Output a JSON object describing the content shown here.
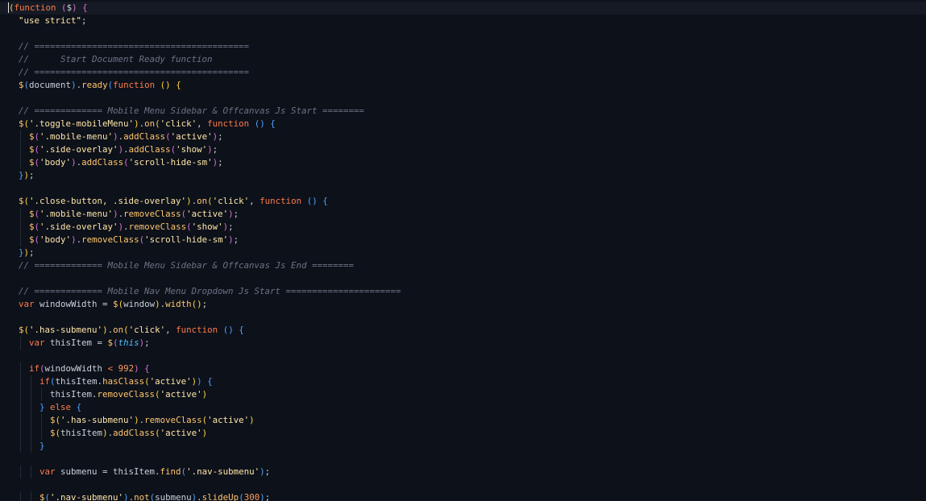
{
  "colors": {
    "background": "#0d111a",
    "current_line": "#151a24",
    "indent_guide": "#232a36",
    "keyword": "#ff7b4a",
    "function": "#ffc66d",
    "string": "#ffe6a8",
    "comment": "#6b7385",
    "bracket_1": "#ffd43b",
    "bracket_2": "#da70d6",
    "bracket_3": "#4fa3ff",
    "number": "#ff9d5c",
    "this": "#4fc1ff",
    "text": "#c9d1d9"
  },
  "code_lines": [
    [
      [
        "cursor",
        "("
      ],
      [
        "kw",
        "function"
      ],
      [
        "punc",
        " "
      ],
      [
        "br2",
        "("
      ],
      [
        "punc",
        "$"
      ],
      [
        "br2",
        ")"
      ],
      [
        "punc",
        " "
      ],
      [
        "br2",
        "{"
      ]
    ],
    [
      [
        "punc",
        "  "
      ],
      [
        "str",
        "\"use strict\""
      ],
      [
        "punc",
        ";"
      ]
    ],
    [],
    [
      [
        "punc",
        "  "
      ],
      [
        "cmt",
        "// ========================================="
      ]
    ],
    [
      [
        "punc",
        "  "
      ],
      [
        "cmt",
        "//      Start Document Ready function"
      ]
    ],
    [
      [
        "punc",
        "  "
      ],
      [
        "cmt",
        "// ========================================="
      ]
    ],
    [
      [
        "punc",
        "  "
      ],
      [
        "fn",
        "$"
      ],
      [
        "br3",
        "("
      ],
      [
        "punc",
        "document"
      ],
      [
        "br3",
        ")"
      ],
      [
        "punc",
        "."
      ],
      [
        "fn",
        "ready"
      ],
      [
        "br3",
        "("
      ],
      [
        "kw",
        "function"
      ],
      [
        "punc",
        " "
      ],
      [
        "br1",
        "()"
      ],
      [
        "punc",
        " "
      ],
      [
        "br1",
        "{"
      ]
    ],
    [],
    [
      [
        "punc",
        "  "
      ],
      [
        "cmt",
        "// ============= Mobile Menu Sidebar & Offcanvas Js Start ========"
      ]
    ],
    [
      [
        "punc",
        "  "
      ],
      [
        "fn",
        "$"
      ],
      [
        "br1",
        "("
      ],
      [
        "str",
        "'.toggle-mobileMenu'"
      ],
      [
        "br1",
        ")"
      ],
      [
        "punc",
        "."
      ],
      [
        "fn",
        "on"
      ],
      [
        "br1",
        "("
      ],
      [
        "str",
        "'click'"
      ],
      [
        "punc",
        ", "
      ],
      [
        "kw",
        "function"
      ],
      [
        "punc",
        " "
      ],
      [
        "br3",
        "()"
      ],
      [
        "punc",
        " "
      ],
      [
        "br3",
        "{"
      ]
    ],
    [
      [
        "punc",
        "    "
      ],
      [
        "fn",
        "$"
      ],
      [
        "br2",
        "("
      ],
      [
        "str",
        "'.mobile-menu'"
      ],
      [
        "br2",
        ")"
      ],
      [
        "punc",
        "."
      ],
      [
        "fn",
        "addClass"
      ],
      [
        "br2",
        "("
      ],
      [
        "str",
        "'active'"
      ],
      [
        "br2",
        ")"
      ],
      [
        "punc",
        ";"
      ]
    ],
    [
      [
        "punc",
        "    "
      ],
      [
        "fn",
        "$"
      ],
      [
        "br2",
        "("
      ],
      [
        "str",
        "'.side-overlay'"
      ],
      [
        "br2",
        ")"
      ],
      [
        "punc",
        "."
      ],
      [
        "fn",
        "addClass"
      ],
      [
        "br2",
        "("
      ],
      [
        "str",
        "'show'"
      ],
      [
        "br2",
        ")"
      ],
      [
        "punc",
        ";"
      ]
    ],
    [
      [
        "punc",
        "    "
      ],
      [
        "fn",
        "$"
      ],
      [
        "br2",
        "("
      ],
      [
        "str",
        "'body'"
      ],
      [
        "br2",
        ")"
      ],
      [
        "punc",
        "."
      ],
      [
        "fn",
        "addClass"
      ],
      [
        "br2",
        "("
      ],
      [
        "str",
        "'scroll-hide-sm'"
      ],
      [
        "br2",
        ")"
      ],
      [
        "punc",
        ";"
      ]
    ],
    [
      [
        "punc",
        "  "
      ],
      [
        "br3",
        "}"
      ],
      [
        "br1",
        ")"
      ],
      [
        "punc",
        ";"
      ]
    ],
    [],
    [
      [
        "punc",
        "  "
      ],
      [
        "fn",
        "$"
      ],
      [
        "br1",
        "("
      ],
      [
        "str",
        "'.close-button, .side-overlay'"
      ],
      [
        "br1",
        ")"
      ],
      [
        "punc",
        "."
      ],
      [
        "fn",
        "on"
      ],
      [
        "br1",
        "("
      ],
      [
        "str",
        "'click'"
      ],
      [
        "punc",
        ", "
      ],
      [
        "kw",
        "function"
      ],
      [
        "punc",
        " "
      ],
      [
        "br3",
        "()"
      ],
      [
        "punc",
        " "
      ],
      [
        "br3",
        "{"
      ]
    ],
    [
      [
        "punc",
        "    "
      ],
      [
        "fn",
        "$"
      ],
      [
        "br2",
        "("
      ],
      [
        "str",
        "'.mobile-menu'"
      ],
      [
        "br2",
        ")"
      ],
      [
        "punc",
        "."
      ],
      [
        "fn",
        "removeClass"
      ],
      [
        "br2",
        "("
      ],
      [
        "str",
        "'active'"
      ],
      [
        "br2",
        ")"
      ],
      [
        "punc",
        ";"
      ]
    ],
    [
      [
        "punc",
        "    "
      ],
      [
        "fn",
        "$"
      ],
      [
        "br2",
        "("
      ],
      [
        "str",
        "'.side-overlay'"
      ],
      [
        "br2",
        ")"
      ],
      [
        "punc",
        "."
      ],
      [
        "fn",
        "removeClass"
      ],
      [
        "br2",
        "("
      ],
      [
        "str",
        "'show'"
      ],
      [
        "br2",
        ")"
      ],
      [
        "punc",
        ";"
      ]
    ],
    [
      [
        "punc",
        "    "
      ],
      [
        "fn",
        "$"
      ],
      [
        "br2",
        "("
      ],
      [
        "str",
        "'body'"
      ],
      [
        "br2",
        ")"
      ],
      [
        "punc",
        "."
      ],
      [
        "fn",
        "removeClass"
      ],
      [
        "br2",
        "("
      ],
      [
        "str",
        "'scroll-hide-sm'"
      ],
      [
        "br2",
        ")"
      ],
      [
        "punc",
        ";"
      ]
    ],
    [
      [
        "punc",
        "  "
      ],
      [
        "br3",
        "}"
      ],
      [
        "br1",
        ")"
      ],
      [
        "punc",
        ";"
      ]
    ],
    [
      [
        "punc",
        "  "
      ],
      [
        "cmt",
        "// ============= Mobile Menu Sidebar & Offcanvas Js End ========"
      ]
    ],
    [],
    [
      [
        "punc",
        "  "
      ],
      [
        "cmt",
        "// ============= Mobile Nav Menu Dropdown Js Start ======================"
      ]
    ],
    [
      [
        "punc",
        "  "
      ],
      [
        "kw",
        "var"
      ],
      [
        "punc",
        " windowWidth = "
      ],
      [
        "fn",
        "$"
      ],
      [
        "br1",
        "("
      ],
      [
        "punc",
        "window"
      ],
      [
        "br1",
        ")"
      ],
      [
        "punc",
        "."
      ],
      [
        "fn",
        "width"
      ],
      [
        "br1",
        "()"
      ],
      [
        "punc",
        ";"
      ]
    ],
    [],
    [
      [
        "punc",
        "  "
      ],
      [
        "fn",
        "$"
      ],
      [
        "br1",
        "("
      ],
      [
        "str",
        "'.has-submenu'"
      ],
      [
        "br1",
        ")"
      ],
      [
        "punc",
        "."
      ],
      [
        "fn",
        "on"
      ],
      [
        "br1",
        "("
      ],
      [
        "str",
        "'click'"
      ],
      [
        "punc",
        ", "
      ],
      [
        "kw",
        "function"
      ],
      [
        "punc",
        " "
      ],
      [
        "br3",
        "()"
      ],
      [
        "punc",
        " "
      ],
      [
        "br3",
        "{"
      ]
    ],
    [
      [
        "punc",
        "    "
      ],
      [
        "kw",
        "var"
      ],
      [
        "punc",
        " thisItem = "
      ],
      [
        "fn",
        "$"
      ],
      [
        "br2",
        "("
      ],
      [
        "this",
        "this"
      ],
      [
        "br2",
        ")"
      ],
      [
        "punc",
        ";"
      ]
    ],
    [],
    [
      [
        "punc",
        "    "
      ],
      [
        "kw",
        "if"
      ],
      [
        "br2",
        "("
      ],
      [
        "punc",
        "windowWidth "
      ],
      [
        "op",
        "<"
      ],
      [
        "punc",
        " "
      ],
      [
        "num",
        "992"
      ],
      [
        "br2",
        ")"
      ],
      [
        "punc",
        " "
      ],
      [
        "br2",
        "{"
      ]
    ],
    [
      [
        "punc",
        "      "
      ],
      [
        "kw",
        "if"
      ],
      [
        "br3",
        "("
      ],
      [
        "punc",
        "thisItem."
      ],
      [
        "fn",
        "hasClass"
      ],
      [
        "br1",
        "("
      ],
      [
        "str",
        "'active'"
      ],
      [
        "br1",
        ")"
      ],
      [
        "br3",
        ")"
      ],
      [
        "punc",
        " "
      ],
      [
        "br3",
        "{"
      ]
    ],
    [
      [
        "punc",
        "        "
      ],
      [
        "punc",
        "thisItem."
      ],
      [
        "fn",
        "removeClass"
      ],
      [
        "br1",
        "("
      ],
      [
        "str",
        "'active'"
      ],
      [
        "br1",
        ")"
      ]
    ],
    [
      [
        "punc",
        "      "
      ],
      [
        "br3",
        "}"
      ],
      [
        "punc",
        " "
      ],
      [
        "kw",
        "else"
      ],
      [
        "punc",
        " "
      ],
      [
        "br3",
        "{"
      ]
    ],
    [
      [
        "punc",
        "        "
      ],
      [
        "fn",
        "$"
      ],
      [
        "br1",
        "("
      ],
      [
        "str",
        "'.has-submenu'"
      ],
      [
        "br1",
        ")"
      ],
      [
        "punc",
        "."
      ],
      [
        "fn",
        "removeClass"
      ],
      [
        "br1",
        "("
      ],
      [
        "str",
        "'active'"
      ],
      [
        "br1",
        ")"
      ]
    ],
    [
      [
        "punc",
        "        "
      ],
      [
        "fn",
        "$"
      ],
      [
        "br1",
        "("
      ],
      [
        "punc",
        "thisItem"
      ],
      [
        "br1",
        ")"
      ],
      [
        "punc",
        "."
      ],
      [
        "fn",
        "addClass"
      ],
      [
        "br1",
        "("
      ],
      [
        "str",
        "'active'"
      ],
      [
        "br1",
        ")"
      ]
    ],
    [
      [
        "punc",
        "      "
      ],
      [
        "br3",
        "}"
      ]
    ],
    [],
    [
      [
        "punc",
        "      "
      ],
      [
        "kw",
        "var"
      ],
      [
        "punc",
        " submenu = thisItem."
      ],
      [
        "fn",
        "find"
      ],
      [
        "br3",
        "("
      ],
      [
        "str",
        "'.nav-submenu'"
      ],
      [
        "br3",
        ")"
      ],
      [
        "punc",
        ";"
      ]
    ],
    [],
    [
      [
        "punc",
        "      "
      ],
      [
        "fn",
        "$"
      ],
      [
        "br3",
        "("
      ],
      [
        "str",
        "'.nav-submenu'"
      ],
      [
        "br3",
        ")"
      ],
      [
        "punc",
        "."
      ],
      [
        "fn",
        "not"
      ],
      [
        "br3",
        "("
      ],
      [
        "punc",
        "submenu"
      ],
      [
        "br3",
        ")"
      ],
      [
        "punc",
        "."
      ],
      [
        "fn",
        "slideUp"
      ],
      [
        "br3",
        "("
      ],
      [
        "num",
        "300"
      ],
      [
        "br3",
        ")"
      ],
      [
        "punc",
        ";"
      ]
    ]
  ]
}
